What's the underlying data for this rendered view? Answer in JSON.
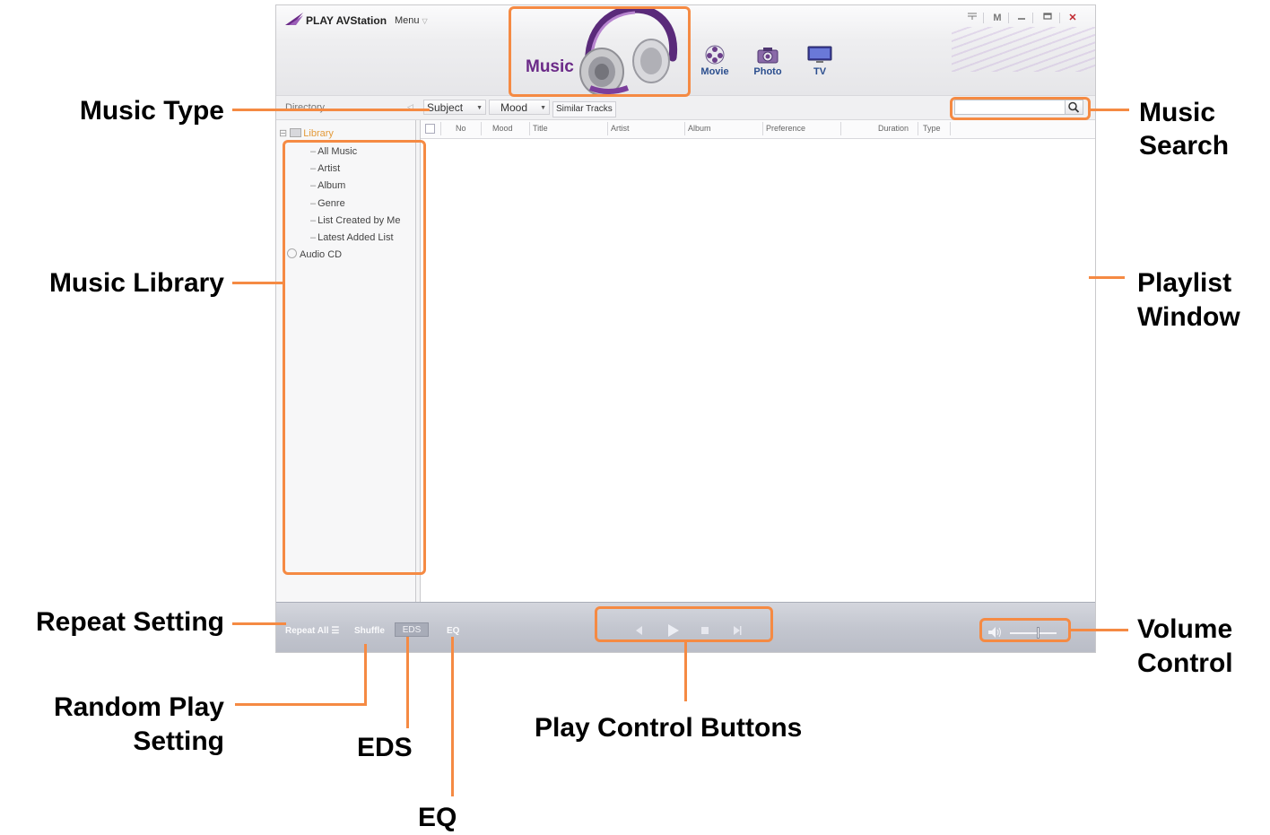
{
  "app": {
    "title": "PLAY AVStation",
    "menu_label": "Menu",
    "window_controls": [
      "mini-mode-icon",
      "M",
      "minimize-icon",
      "maximize-icon",
      "close-icon"
    ]
  },
  "categories": {
    "music": "Music",
    "movie": "Movie",
    "photo": "Photo",
    "tv": "TV"
  },
  "toolbar": {
    "directory_label": "Directory",
    "subject_dropdown": "Subject",
    "mood_dropdown": "Mood",
    "similar_tracks": "Similar Tracks",
    "search_placeholder": ""
  },
  "library": {
    "root": "Library",
    "items": [
      "All Music",
      "Artist",
      "Album",
      "Genre",
      "List Created by Me",
      "Latest Added List"
    ],
    "audio_cd": "Audio CD"
  },
  "playlist": {
    "columns": [
      "No",
      "Mood",
      "Title",
      "Artist",
      "Album",
      "Preference",
      "Duration",
      "Type"
    ]
  },
  "controls": {
    "repeat": "Repeat All",
    "shuffle": "Shuffle",
    "eds": "EDS",
    "eq": "EQ"
  },
  "colors": {
    "annotation": "#f58a43",
    "music_accent": "#6b2a88",
    "library_link": "#e39a3a",
    "category_label": "#2b4e8e",
    "close_button": "#c0262d"
  },
  "annotations": {
    "music_type": "Music Type",
    "music_search": [
      "Music",
      "Search"
    ],
    "music_library": "Music Library",
    "playlist_window": [
      "Playlist",
      "Window"
    ],
    "repeat_setting": "Repeat Setting",
    "random_play": [
      "Random Play",
      "Setting"
    ],
    "eds": "EDS",
    "eq": "EQ",
    "play_controls": "Play Control Buttons",
    "volume_control": [
      "Volume",
      "Control"
    ]
  }
}
